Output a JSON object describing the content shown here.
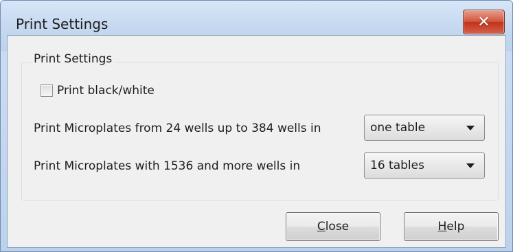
{
  "window": {
    "title": "Print Settings",
    "close_glyph": "✕"
  },
  "group": {
    "label": "Print Settings"
  },
  "options": {
    "bw_label": "Print black/white",
    "bw_checked": false,
    "row1_label": "Print Microplates from 24 wells up to 384 wells in",
    "row1_value": "one table",
    "row2_label": "Print Microplates with 1536 and more wells in",
    "row2_value": "16 tables"
  },
  "buttons": {
    "close_mnemonic": "C",
    "close_rest": "lose",
    "help_mnemonic": "H",
    "help_rest": "elp"
  },
  "icons": {
    "close": "close-icon",
    "dropdown": "chevron-down-icon"
  },
  "colors": {
    "close_button": "#c9432a",
    "client_bg": "#f0f0f0",
    "titlebar": "#c4d8ef"
  }
}
